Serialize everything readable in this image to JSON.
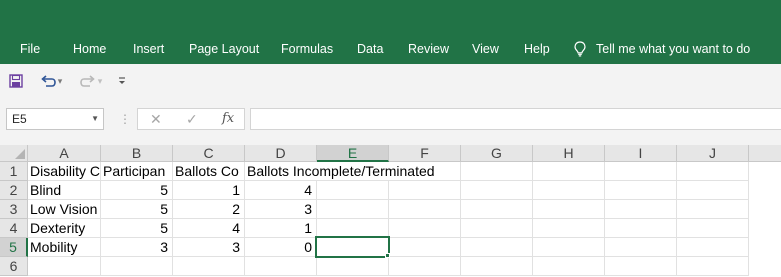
{
  "ribbon": {
    "tabs": [
      "File",
      "Home",
      "Insert",
      "Page Layout",
      "Formulas",
      "Data",
      "Review",
      "View",
      "Help"
    ],
    "tell_me": "Tell me what you want to do",
    "accent_color": "#217346"
  },
  "quick_access": {
    "icons": [
      "save-icon",
      "undo-icon",
      "redo-icon",
      "customize-icon"
    ]
  },
  "formula_bar": {
    "name_box": "E5",
    "fx_label": "fx",
    "formula": ""
  },
  "sheet": {
    "columns": [
      "A",
      "B",
      "C",
      "D",
      "E",
      "F",
      "G",
      "H",
      "I",
      "J"
    ],
    "rows": [
      "1",
      "2",
      "3",
      "4",
      "5",
      "6"
    ],
    "active_column": "E",
    "active_row": "5",
    "active_cell": "E5",
    "cells": [
      [
        "Disability C",
        "Participan",
        "Ballots Co",
        "Ballots Incomplete/Terminated",
        "",
        ""
      ],
      [
        "Blind",
        "5",
        "1",
        "4",
        "",
        ""
      ],
      [
        "Low Vision",
        "5",
        "2",
        "3",
        "",
        ""
      ],
      [
        "Dexterity",
        "5",
        "4",
        "1",
        "",
        ""
      ],
      [
        "Mobility",
        "3",
        "3",
        "0",
        "",
        ""
      ],
      [
        "",
        "",
        "",
        "",
        "",
        ""
      ]
    ]
  }
}
